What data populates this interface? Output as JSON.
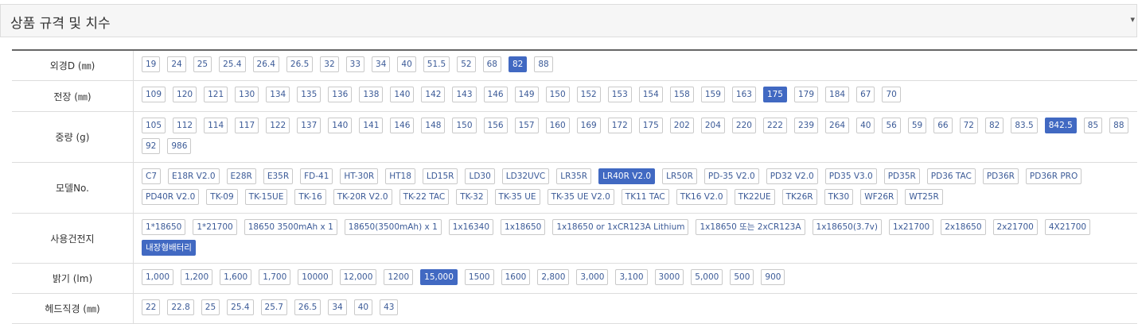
{
  "panel": {
    "title": "상품 규격 및 치수"
  },
  "rows": [
    {
      "label": "외경D (㎜)",
      "selected": "82",
      "options": [
        "19",
        "24",
        "25",
        "25.4",
        "26.4",
        "26.5",
        "32",
        "33",
        "34",
        "40",
        "51.5",
        "52",
        "68",
        "82",
        "88"
      ]
    },
    {
      "label": "전장 (㎜)",
      "selected": "175",
      "options": [
        "109",
        "120",
        "121",
        "130",
        "134",
        "135",
        "136",
        "138",
        "140",
        "142",
        "143",
        "146",
        "149",
        "150",
        "152",
        "153",
        "154",
        "158",
        "159",
        "163",
        "175",
        "179",
        "184",
        "67",
        "70"
      ]
    },
    {
      "label": "중량 (g)",
      "selected": "842.5",
      "options": [
        "105",
        "112",
        "114",
        "117",
        "122",
        "137",
        "140",
        "141",
        "146",
        "148",
        "150",
        "156",
        "157",
        "160",
        "169",
        "172",
        "175",
        "202",
        "204",
        "220",
        "222",
        "239",
        "264",
        "40",
        "56",
        "59",
        "66",
        "72",
        "82",
        "83.5",
        "842.5",
        "85",
        "88",
        "92",
        "986"
      ]
    },
    {
      "label": "모델No.",
      "selected": "LR40R V2.0",
      "options": [
        "C7",
        "E18R V2.0",
        "E28R",
        "E35R",
        "FD-41",
        "HT-30R",
        "HT18",
        "LD15R",
        "LD30",
        "LD32UVC",
        "LR35R",
        "LR40R V2.0",
        "LR50R",
        "PD-35 V2.0",
        "PD32 V2.0",
        "PD35 V3.0",
        "PD35R",
        "PD36 TAC",
        "PD36R",
        "PD36R PRO",
        "PD40R V2.0",
        "TK-09",
        "TK-15UE",
        "TK-16",
        "TK-20R V2.0",
        "TK-22 TAC",
        "TK-32",
        "TK-35 UE",
        "TK-35 UE V2.0",
        "TK11 TAC",
        "TK16 V2.0",
        "TK22UE",
        "TK26R",
        "TK30",
        "WF26R",
        "WT25R"
      ]
    },
    {
      "label": "사용건전지",
      "selected": "내장형배터리",
      "options": [
        "1*18650",
        "1*21700",
        "18650 3500mAh x 1",
        "18650(3500mAh) x 1",
        "1x16340",
        "1x18650",
        "1x18650 or 1xCR123A Lithium",
        "1x18650 또는 2xCR123A",
        "1x18650(3.7v)",
        "1x21700",
        "2x18650",
        "2x21700",
        "4X21700",
        "내장형배터리"
      ]
    },
    {
      "label": "밝기 (lm)",
      "selected": "15,000",
      "options": [
        "1,000",
        "1,200",
        "1,600",
        "1,700",
        "10000",
        "12,000",
        "1200",
        "15,000",
        "1500",
        "1600",
        "2,800",
        "3,000",
        "3,100",
        "3000",
        "5,000",
        "500",
        "900"
      ]
    },
    {
      "label": "헤드직경 (㎜)",
      "selected": "",
      "options": [
        "22",
        "22.8",
        "25",
        "25.4",
        "25.7",
        "26.5",
        "34",
        "40",
        "43"
      ]
    }
  ]
}
